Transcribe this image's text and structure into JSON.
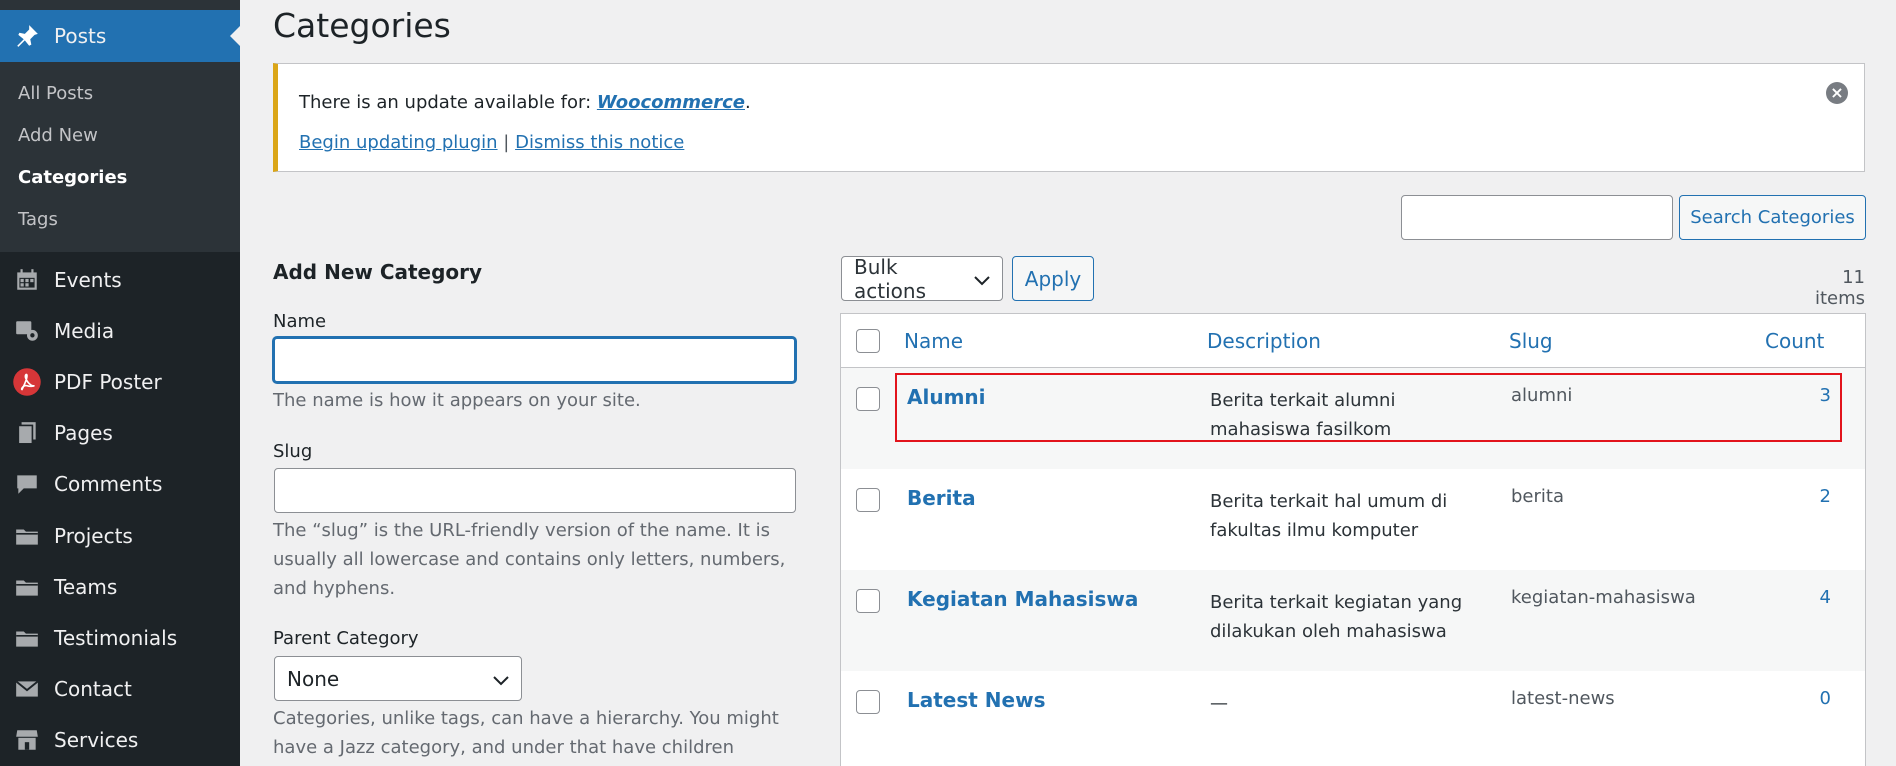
{
  "sidebar": {
    "posts_label": "Posts",
    "posts_icon": "pin-icon",
    "submenu": [
      "All Posts",
      "Add New",
      "Categories",
      "Tags"
    ],
    "active_submenu": "Categories",
    "items": [
      {
        "label": "Events",
        "icon": "calendar-icon"
      },
      {
        "label": "Media",
        "icon": "media-icon"
      },
      {
        "label": "PDF Poster",
        "icon": "pdf-icon"
      },
      {
        "label": "Pages",
        "icon": "pages-icon"
      },
      {
        "label": "Comments",
        "icon": "comment-icon"
      },
      {
        "label": "Projects",
        "icon": "folder-icon"
      },
      {
        "label": "Teams",
        "icon": "folder-icon"
      },
      {
        "label": "Testimonials",
        "icon": "folder-icon"
      },
      {
        "label": "Contact",
        "icon": "mail-icon"
      },
      {
        "label": "Services",
        "icon": "store-icon"
      }
    ]
  },
  "page": {
    "title": "Categories"
  },
  "notice": {
    "text_prefix": "There is an update available for: ",
    "plugin": "Woocommerce",
    "text_suffix": ".",
    "begin_link": "Begin updating plugin",
    "separator": " | ",
    "dismiss_link": "Dismiss this notice",
    "close_glyph": "×"
  },
  "search": {
    "value": "",
    "button_label": "Search Categories"
  },
  "form": {
    "heading": "Add New Category",
    "name_label": "Name",
    "name_value": "",
    "name_help": "The name is how it appears on your site.",
    "slug_label": "Slug",
    "slug_value": "",
    "slug_help": "The “slug” is the URL-friendly version of the name. It is usually all lowercase and contains only letters, numbers, and hyphens.",
    "parent_label": "Parent Category",
    "parent_value": "None",
    "parent_help": "Categories, unlike tags, can have a hierarchy. You might have a Jazz category, and under that have children"
  },
  "list": {
    "bulk_label": "Bulk actions",
    "apply_label": "Apply",
    "items_count": "11 items",
    "columns": {
      "name": "Name",
      "description": "Description",
      "slug": "Slug",
      "count": "Count"
    },
    "rows": [
      {
        "name": "Alumni",
        "description": "Berita terkait alumni mahasiswa fasilkom",
        "slug": "alumni",
        "count": "3"
      },
      {
        "name": "Berita",
        "description": "Berita terkait hal umum di fakultas ilmu komputer",
        "slug": "berita",
        "count": "2"
      },
      {
        "name": "Kegiatan Mahasiswa",
        "description": "Berita terkait kegiatan yang dilakukan oleh mahasiswa",
        "slug": "kegiatan-mahasiswa",
        "count": "4"
      },
      {
        "name": "Latest News",
        "description": "—",
        "slug": "latest-news",
        "count": "0"
      }
    ]
  },
  "colors": {
    "sidebar_bg": "#1d2327",
    "accent": "#2271b1",
    "notice_border": "#dba617",
    "highlight": "#e2141c"
  }
}
